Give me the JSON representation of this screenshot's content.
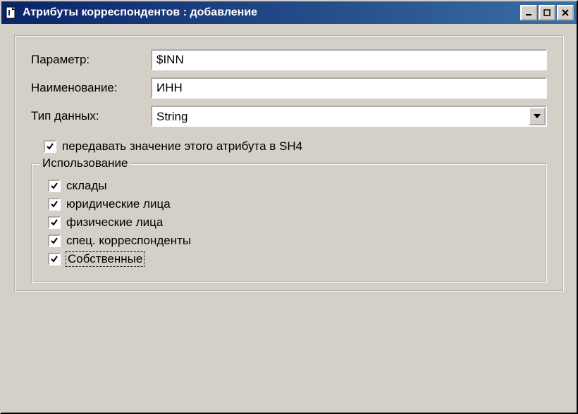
{
  "window": {
    "title": "Атрибуты корреспондентов : добавление"
  },
  "form": {
    "parameter_label": "Параметр:",
    "parameter_value": "$INN",
    "name_label": "Наименование:",
    "name_value": "ИНН",
    "datatype_label": "Тип данных:",
    "datatype_value": "String",
    "sh4_label": "передавать значение этого атрибута в SH4"
  },
  "usage": {
    "legend": "Использование",
    "items": [
      {
        "label": "склады"
      },
      {
        "label": "юридические лица"
      },
      {
        "label": "физические лица"
      },
      {
        "label": "спец. корреспонденты"
      },
      {
        "label": "Собственные"
      }
    ]
  }
}
